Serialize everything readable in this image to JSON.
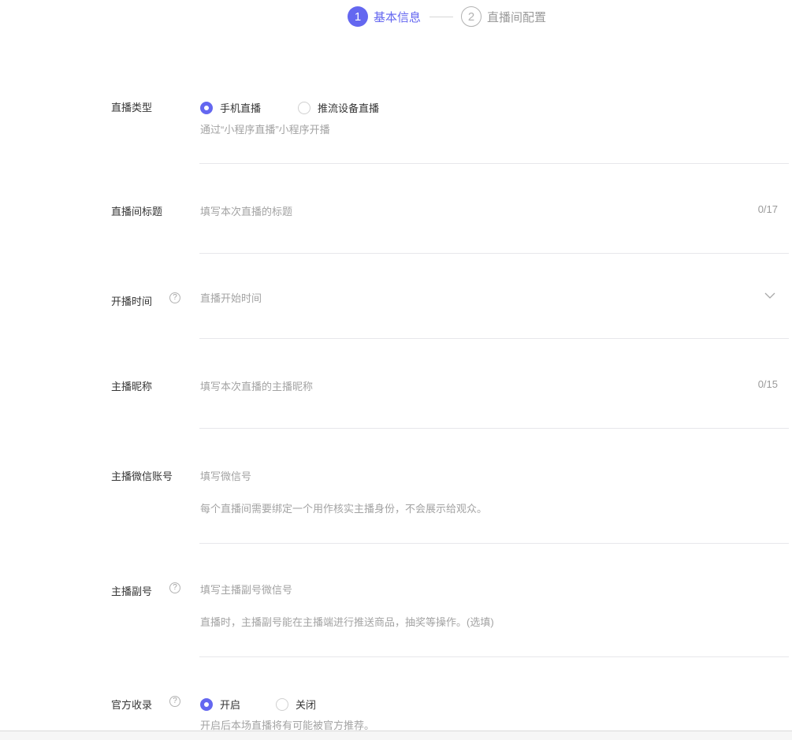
{
  "steps": [
    {
      "num": "1",
      "label": "基本信息"
    },
    {
      "num": "2",
      "label": "直播间配置"
    }
  ],
  "live_type": {
    "label": "直播类型",
    "options": [
      "手机直播",
      "推流设备直播"
    ],
    "selected": "手机直播",
    "hint": "通过“小程序直播”小程序开播"
  },
  "title": {
    "label": "直播间标题",
    "placeholder": "填写本次直播的标题",
    "counter": "0/17"
  },
  "start_time": {
    "label": "开播时间",
    "help": "?",
    "placeholder": "直播开始时间",
    "icon": "chevron-down-icon"
  },
  "anchor_name": {
    "label": "主播昵称",
    "placeholder": "填写本次直播的主播昵称",
    "counter": "0/15"
  },
  "anchor_wechat": {
    "label": "主播微信账号",
    "placeholder": "填写微信号",
    "hint": "每个直播间需要绑定一个用作核实主播身份，不会展示给观众。"
  },
  "sub_anchor": {
    "label": "主播副号",
    "help": "?",
    "placeholder": "填写主播副号微信号",
    "hint": "直播时，主播副号能在主播端进行推送商品，抽奖等操作。(选填)"
  },
  "official_include": {
    "label": "官方收录",
    "help": "?",
    "options": [
      "开启",
      "关闭"
    ],
    "selected": "开启",
    "hint": "开启后本场直播将有可能被官方推荐。"
  },
  "colors": {
    "accent": "#6467f0",
    "placeholder": "#a3a3a3",
    "divider": "#e7e7eb"
  }
}
